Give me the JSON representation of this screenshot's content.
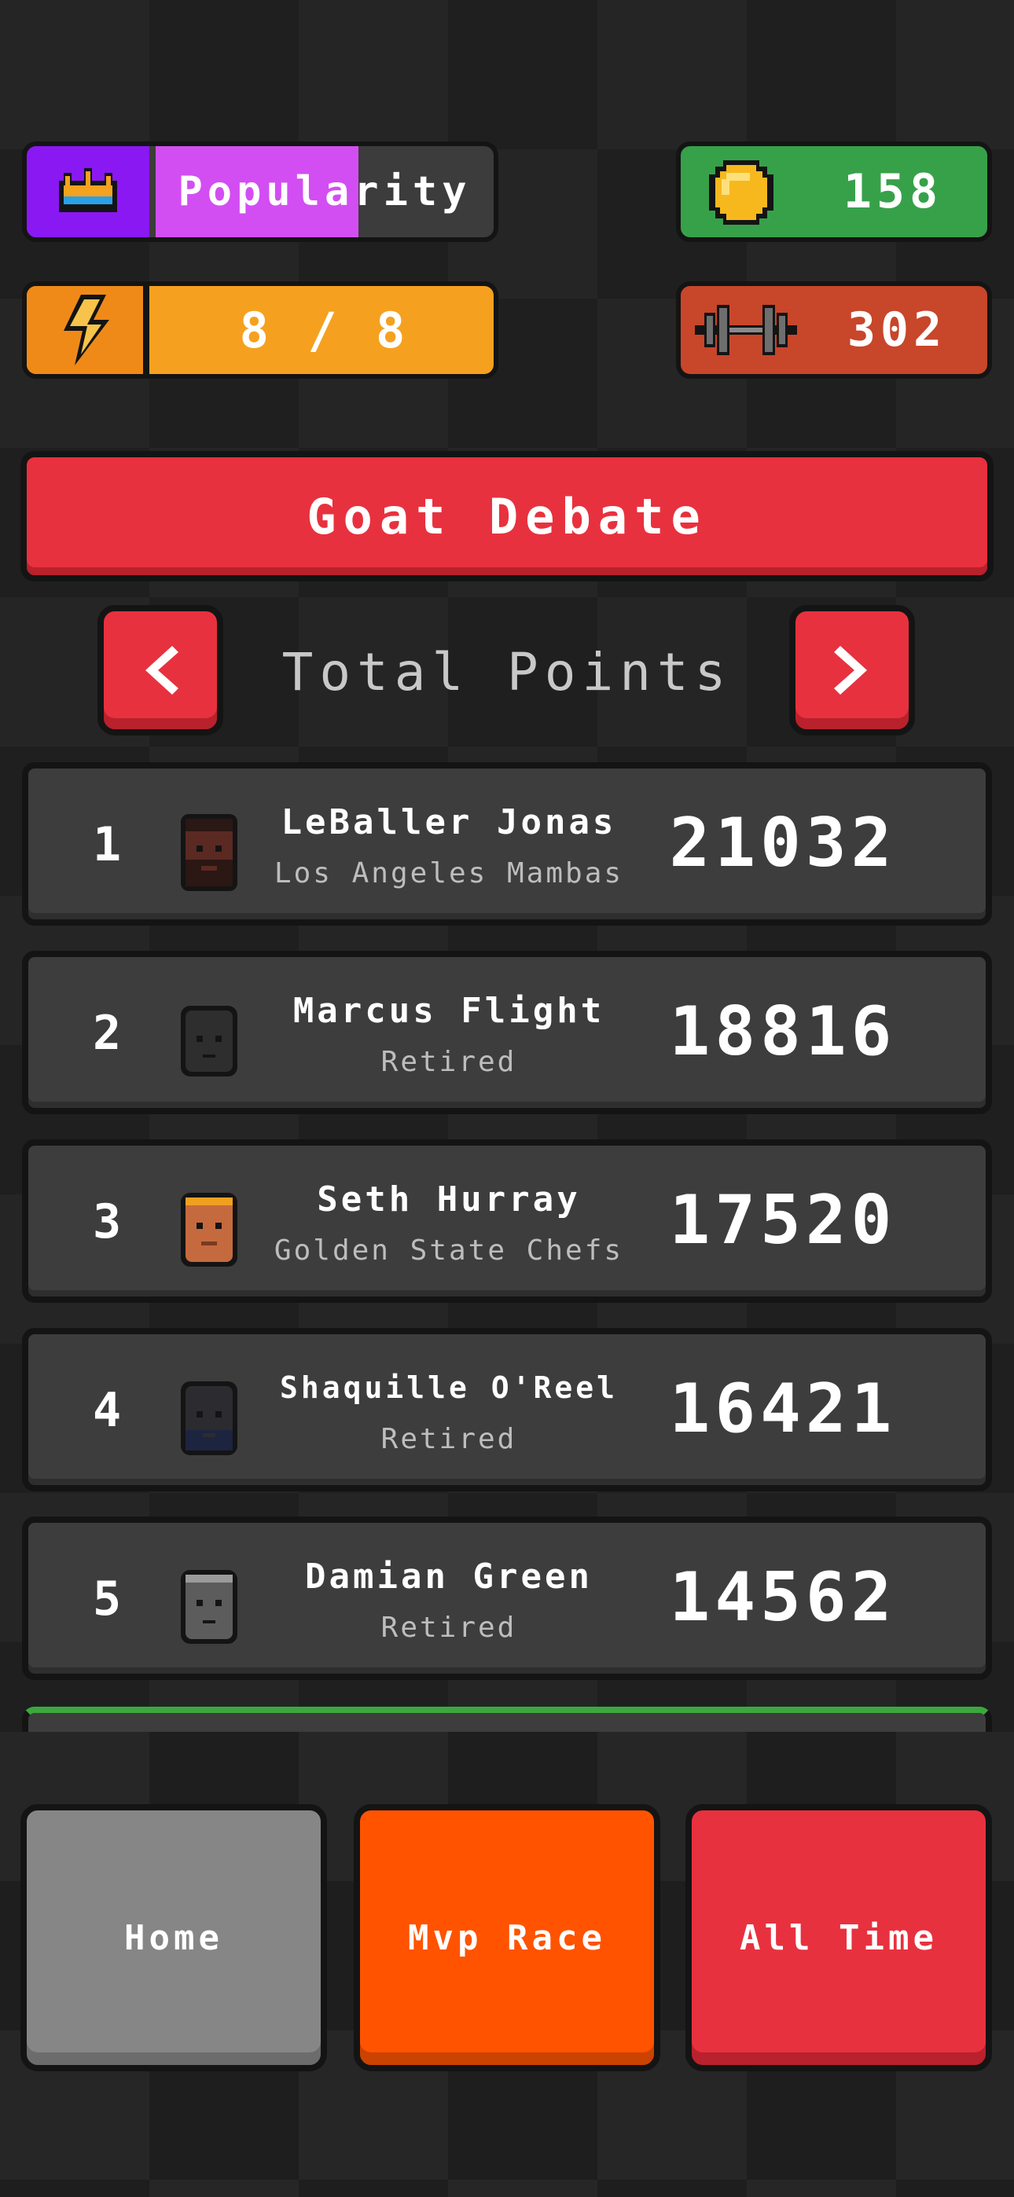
{
  "stats": {
    "popularity": {
      "label": "Popularity",
      "fill_fraction": 0.6
    },
    "coins": {
      "value": "158"
    },
    "energy": {
      "value": "8 / 8"
    },
    "strength": {
      "value": "302"
    }
  },
  "header": {
    "title": "Goat Debate"
  },
  "category": {
    "label": "Total Points",
    "prev_label": "<",
    "next_label": ">"
  },
  "leaderboard": [
    {
      "rank": "1",
      "name": "LeBaller Jonas",
      "team": "Los Angeles Mambas",
      "score": "21032",
      "avatar": "avatar-dark-bearded"
    },
    {
      "rank": "2",
      "name": "Marcus Flight",
      "team": "Retired",
      "score": "18816",
      "avatar": "avatar-dark"
    },
    {
      "rank": "3",
      "name": "Seth Hurray",
      "team": "Golden State Chefs",
      "score": "17520",
      "avatar": "avatar-orange-headband"
    },
    {
      "rank": "4",
      "name": "Shaquille O'Reel",
      "team": "Retired",
      "score": "16421",
      "avatar": "avatar-dark-beard"
    },
    {
      "rank": "5",
      "name": "Damian Green",
      "team": "Retired",
      "score": "14562",
      "avatar": "avatar-gray-headband"
    }
  ],
  "bottom_nav": {
    "home": "Home",
    "mvp_race": "Mvp Race",
    "all_time": "All Time"
  },
  "colors": {
    "popularity_purple": "#8a18f2",
    "popularity_fill": "#d24ef2",
    "coins_green": "#37a14a",
    "energy_orange": "#f5a11f",
    "strength_red": "#c8462a",
    "accent_red": "#e8313e",
    "home_gray": "#868686",
    "mvp_orange": "#ff5300",
    "row_bg": "#3d3d3d"
  }
}
